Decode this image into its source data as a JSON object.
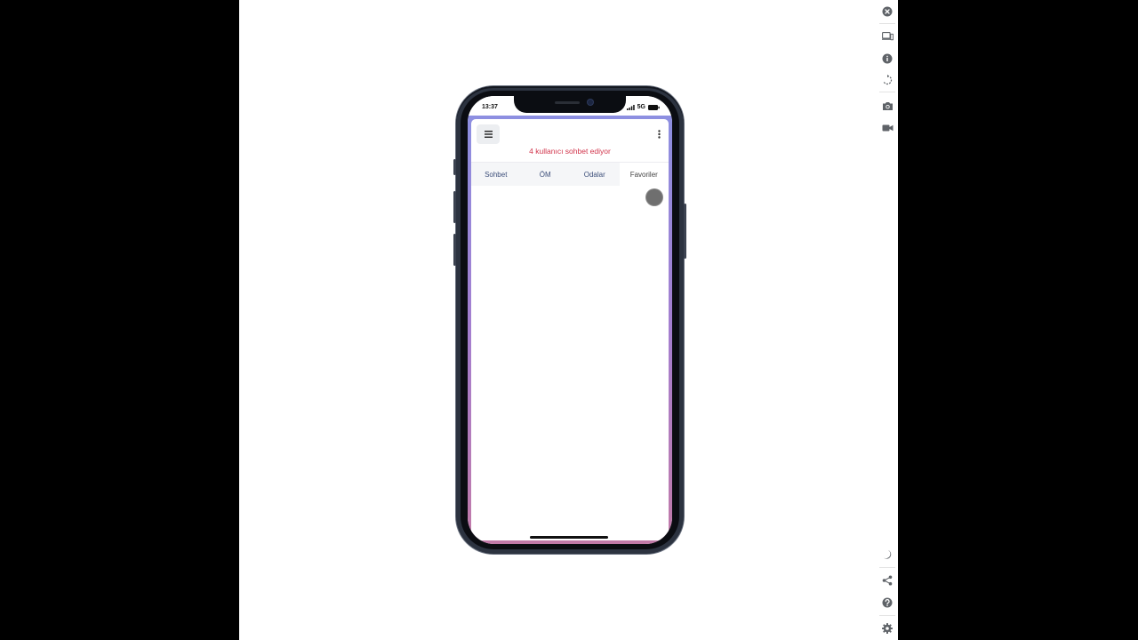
{
  "device": {
    "status_time": "13:37",
    "network": "5G"
  },
  "app": {
    "online_text": "4 kullanıcı sohbet ediyor",
    "tabs": [
      {
        "label": "Sohbet",
        "active": false
      },
      {
        "label": "ÖM",
        "active": false
      },
      {
        "label": "Odalar",
        "active": false
      },
      {
        "label": "Favoriler",
        "active": true
      }
    ],
    "icons": {
      "menu": "hamburger-menu-icon",
      "more": "kebab-menu-icon",
      "fab": "circle-button"
    },
    "colors": {
      "online_text": "#d1344b",
      "tab_text": "#3d4f7a",
      "frame_top": "#8d8fe1",
      "frame_bottom": "#c27aa8"
    }
  },
  "toolbar": {
    "icons": [
      "close-icon",
      "device-icon",
      "info-icon",
      "rotate-icon",
      "camera-icon",
      "video-icon",
      "dark-mode-icon",
      "share-icon",
      "help-icon",
      "settings-icon"
    ]
  }
}
